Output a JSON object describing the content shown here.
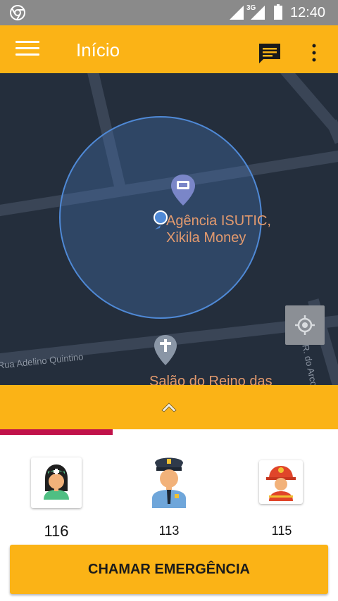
{
  "status_bar": {
    "network_type": "3G",
    "time": "12:40"
  },
  "app_bar": {
    "title": "Início",
    "icons": [
      "menu-icon",
      "chat-icon",
      "more-vert-icon"
    ]
  },
  "map": {
    "places": [
      {
        "name": "Agência ISUTIC,\nXikila Money",
        "icon": "atm-pin-icon"
      },
      {
        "name": "Salão do Reino das",
        "icon": "church-pin-icon"
      }
    ],
    "roads": [
      "Rua Adelino Quintino",
      "R. do Arco"
    ],
    "icons": [
      "my-location-dot-icon",
      "locate-me-icon"
    ]
  },
  "panel": {
    "icon": "chevron-up-icon"
  },
  "services": [
    {
      "number": "116",
      "icon": "nurse-icon"
    },
    {
      "number": "113",
      "icon": "police-officer-icon"
    },
    {
      "number": "115",
      "icon": "firefighter-icon"
    }
  ],
  "action": {
    "call_label": "CHAMAR EMERGÊNCIA"
  },
  "colors": {
    "accent": "#fbb316",
    "map_background": "#242e3c",
    "highlight": "#c0124a",
    "status_bar": "#8a8a8a"
  }
}
